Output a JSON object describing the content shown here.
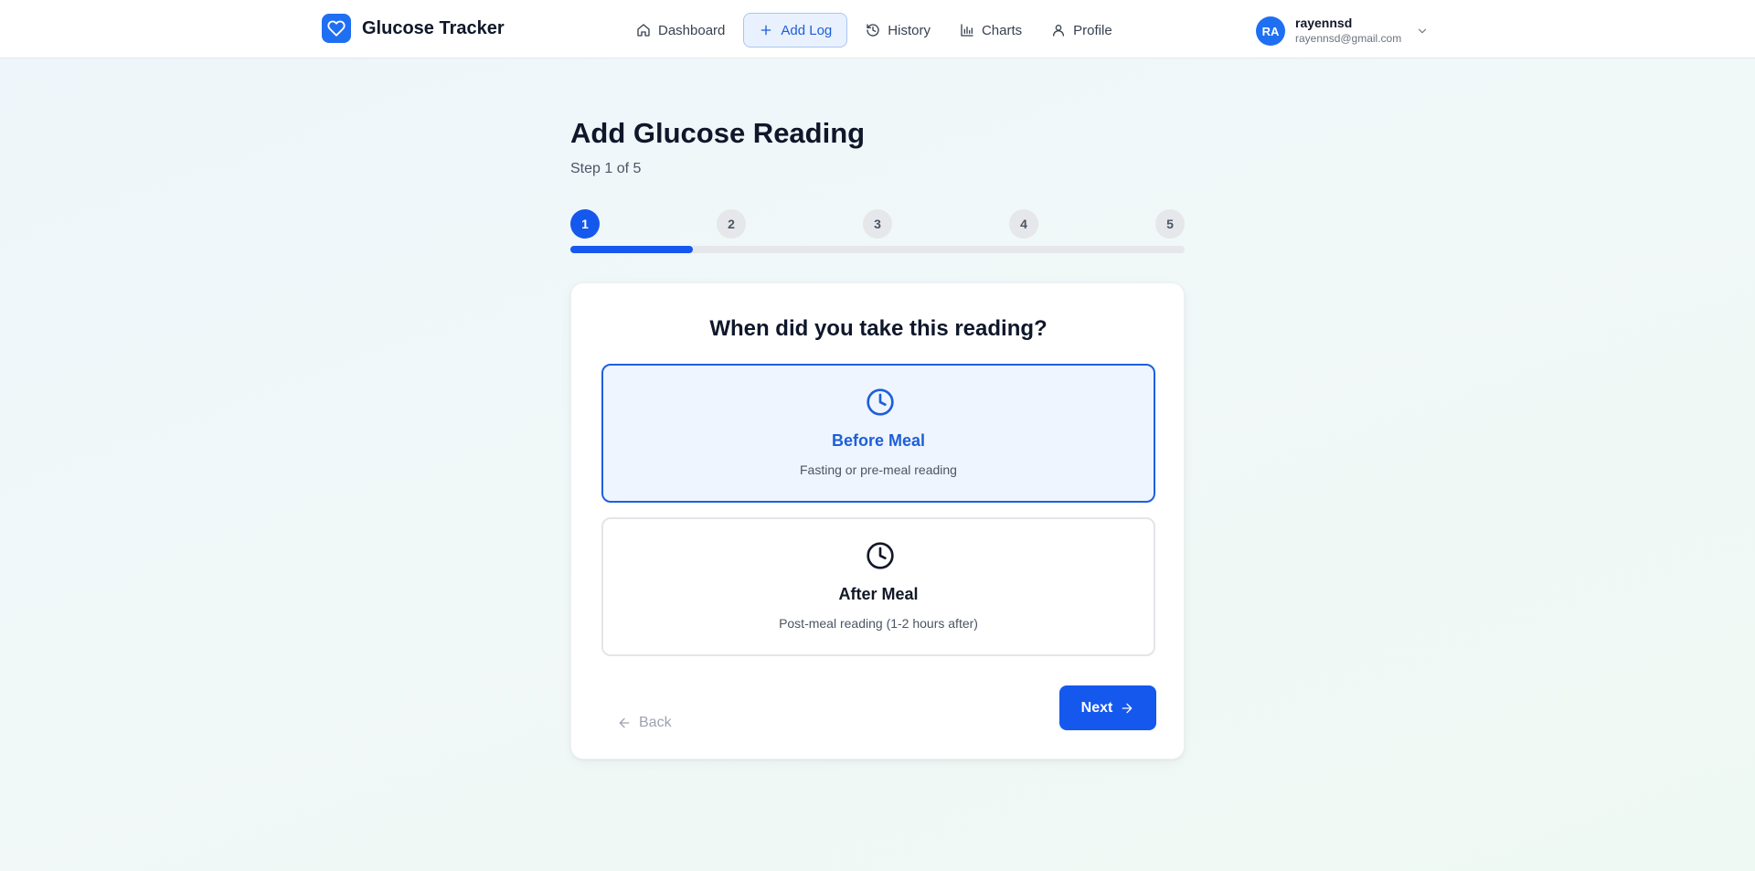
{
  "app": {
    "name": "Glucose Tracker",
    "logo_icon": "heart-icon",
    "accent_color": "#1558ee"
  },
  "nav": {
    "items": [
      {
        "label": "Dashboard",
        "icon": "home-icon",
        "active": false
      },
      {
        "label": "Add Log",
        "icon": "plus-icon",
        "active": true
      },
      {
        "label": "History",
        "icon": "history-icon",
        "active": false
      },
      {
        "label": "Charts",
        "icon": "bar-chart-icon",
        "active": false
      },
      {
        "label": "Profile",
        "icon": "user-icon",
        "active": false
      }
    ]
  },
  "user": {
    "initials": "RA",
    "name": "rayennsd",
    "email": "rayennsd@gmail.com",
    "menu_icon": "chevron-down-icon"
  },
  "page": {
    "title": "Add Glucose Reading",
    "step_label": "Step 1 of 5",
    "current_step": 1,
    "steps": [
      "1",
      "2",
      "3",
      "4",
      "5"
    ],
    "progress_fraction": 0.2
  },
  "question": {
    "text": "When did you take this reading?",
    "options": [
      {
        "title": "Before Meal",
        "description": "Fasting or pre-meal reading",
        "icon": "clock-icon",
        "selected": true
      },
      {
        "title": "After Meal",
        "description": "Post-meal reading (1-2 hours after)",
        "icon": "clock-icon",
        "selected": false
      }
    ]
  },
  "actions": {
    "back_label": "Back",
    "back_icon": "arrow-left-icon",
    "next_label": "Next",
    "next_icon": "arrow-right-icon"
  }
}
